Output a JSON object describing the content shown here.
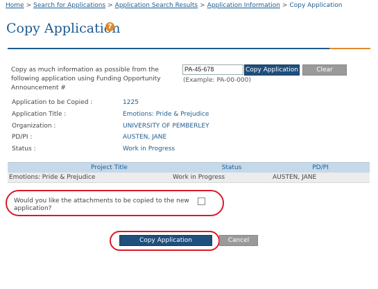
{
  "breadcrumb": {
    "items": [
      "Home",
      "Search for Applications",
      "Application Search Results",
      "Application Information"
    ],
    "separator": ">",
    "current": "Copy Application"
  },
  "page": {
    "title": "Copy Application",
    "help_icon": "?"
  },
  "copy_section": {
    "instruction": "Copy as much information as possible from the following application using Funding Opportunity Announcement #",
    "fon_input_value": "PA-45-678",
    "example": "(Example: PA-00-000)",
    "copy_button": "Copy Application",
    "clear_button": "Clear"
  },
  "details": [
    {
      "label": "Application to be Copied :",
      "value": "1225"
    },
    {
      "label": "Application Title :",
      "value": "Emotions: Pride & Prejudice"
    },
    {
      "label": "Organization :",
      "value": "UNIVERSITY OF PEMBERLEY"
    },
    {
      "label": "PD/PI :",
      "value": "AUSTEN, JANE"
    },
    {
      "label": "Status :",
      "value": "Work in Progress"
    }
  ],
  "table": {
    "columns": [
      "Project Title",
      "Status",
      "PD/PI"
    ],
    "rows": [
      [
        "Emotions: Pride & Prejudice",
        "Work in Progress",
        "AUSTEN, JANE"
      ]
    ]
  },
  "attachments": {
    "question": "Would you like the attachments to be copied to the new application?",
    "checked": false
  },
  "actions": {
    "copy": "Copy Application",
    "cancel": "Cancel"
  },
  "colors": {
    "primary": "#1e4f7d",
    "accent": "#e08a2b",
    "highlight": "#d8192a",
    "link": "#1d5d92"
  }
}
